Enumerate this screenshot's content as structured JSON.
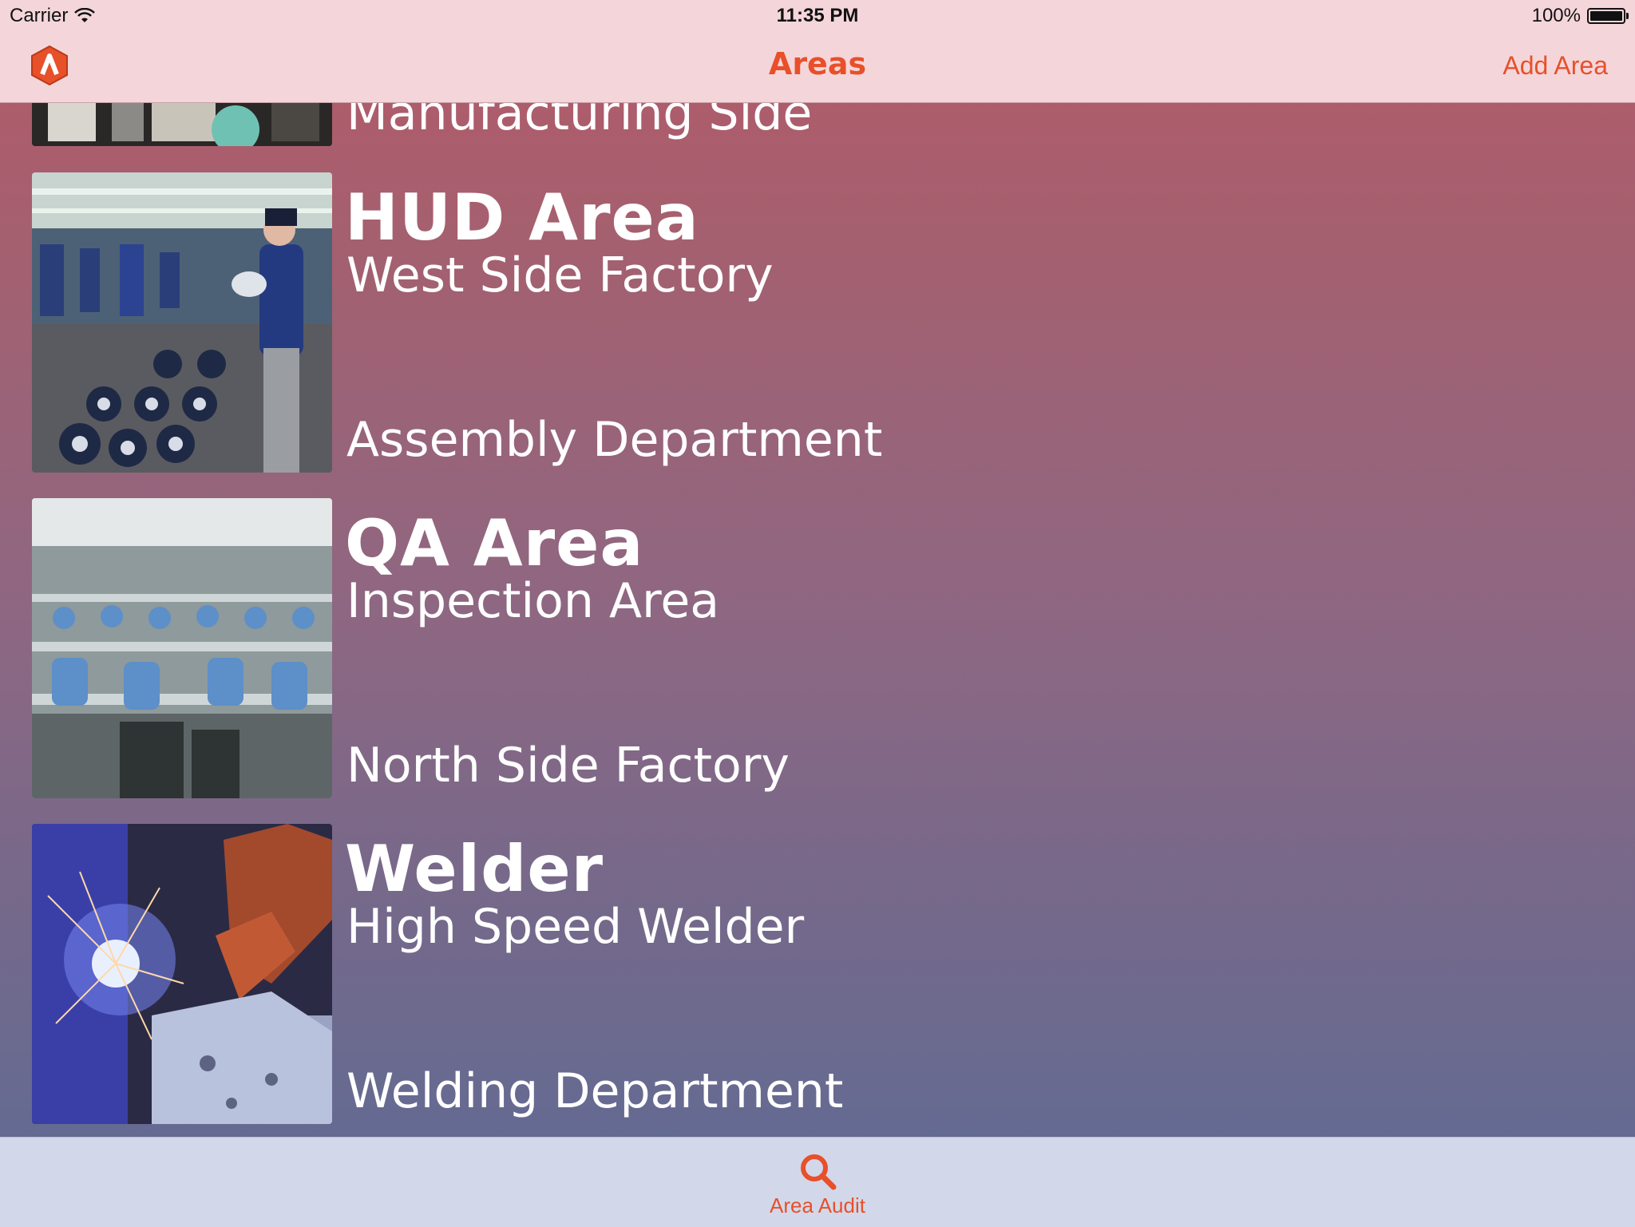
{
  "status_bar": {
    "carrier": "Carrier",
    "time": "11:35 PM",
    "battery": "100%"
  },
  "nav": {
    "title": "Areas",
    "add_button": "Add Area",
    "logo_icon": "app-logo-icon"
  },
  "areas": [
    {
      "name": "",
      "location": "Manufacturing Side",
      "department": ""
    },
    {
      "name": "HUD Area",
      "location": "West Side Factory",
      "department": "Assembly Department"
    },
    {
      "name": "QA Area",
      "location": "Inspection Area",
      "department": "North Side Factory"
    },
    {
      "name": "Welder",
      "location": "High Speed Welder",
      "department": "Welding Department"
    }
  ],
  "tab_bar": {
    "items": [
      {
        "label": "Area Audit",
        "icon": "search-icon"
      }
    ]
  },
  "colors": {
    "accent": "#e8502a",
    "bar_background": "#f4d6da",
    "tab_background": "#d2d8ea"
  }
}
